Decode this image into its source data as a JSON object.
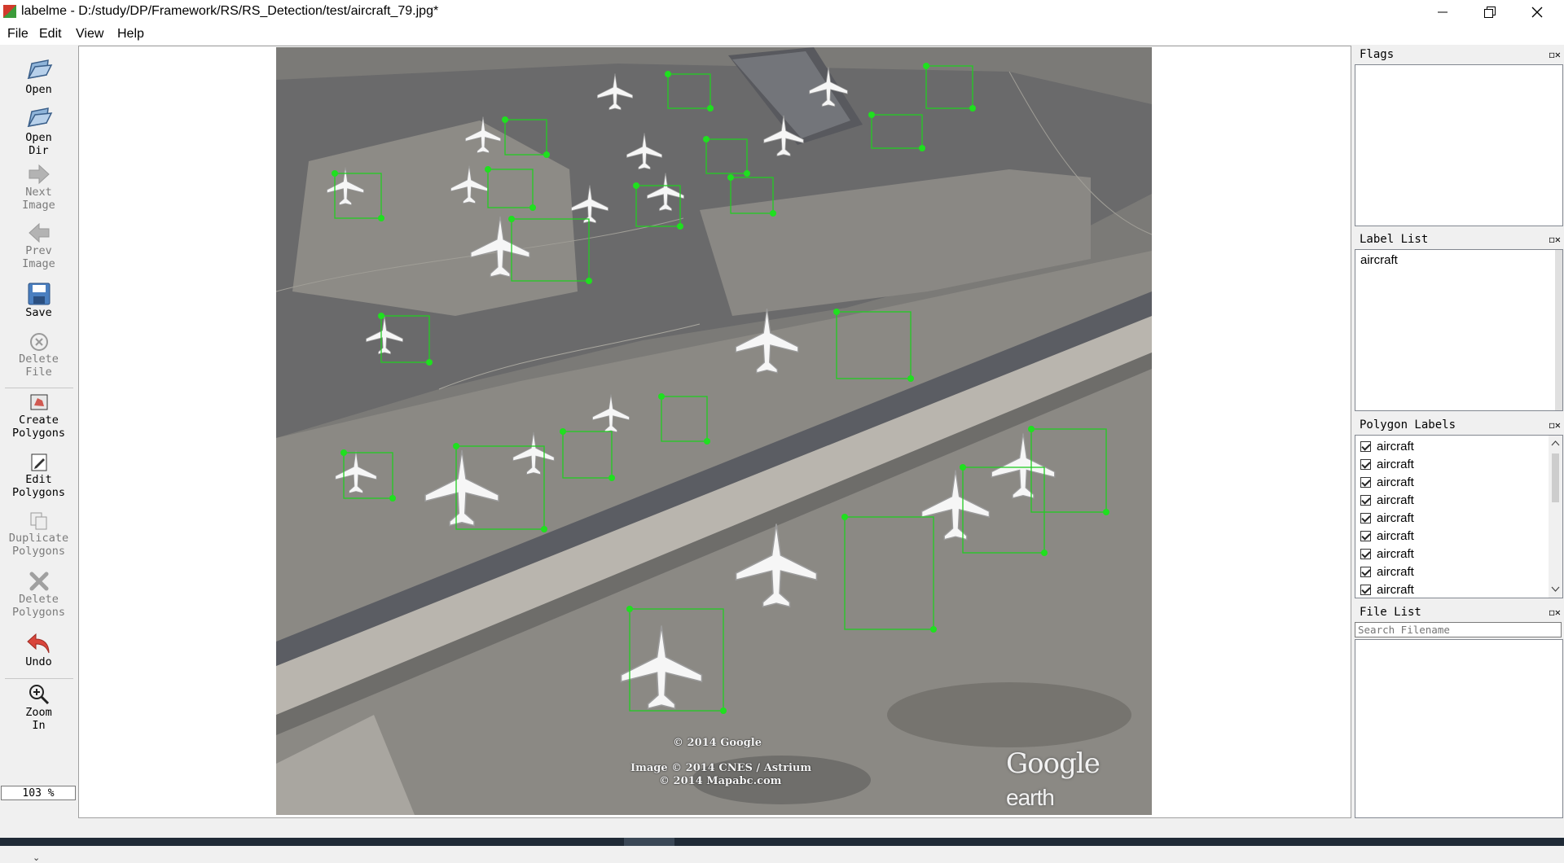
{
  "window": {
    "title": "labelme - D:/study/DP/Framework/RS/RS_Detection/test/aircraft_79.jpg*",
    "app_icon": "labelme-icon",
    "controls": [
      "minimize-icon",
      "restore-icon",
      "close-icon"
    ]
  },
  "menu": {
    "file": "File",
    "edit": "Edit",
    "view": "View",
    "help": "Help"
  },
  "toolbar": {
    "open": {
      "label": "Open",
      "icon": "folder-open-icon"
    },
    "open_dir": {
      "label": "Open\nDir",
      "icon": "folder-open-icon"
    },
    "next_image": {
      "label": "Next\nImage",
      "icon": "arrow-right-icon",
      "enabled": false
    },
    "prev_image": {
      "label": "Prev\nImage",
      "icon": "arrow-left-icon",
      "enabled": false
    },
    "save": {
      "label": "Save",
      "icon": "floppy-disk-icon"
    },
    "delete_file": {
      "label": "Delete\nFile",
      "icon": "delete-circle-icon",
      "enabled": false
    },
    "create_polygons": {
      "label": "Create\nPolygons",
      "icon": "create-polygon-icon"
    },
    "edit_polygons": {
      "label": "Edit\nPolygons",
      "icon": "edit-pencil-icon"
    },
    "duplicate_polygons": {
      "label": "Duplicate\nPolygons",
      "icon": "copy-icon",
      "enabled": false
    },
    "delete_polygons": {
      "label": "Delete\nPolygons",
      "icon": "delete-x-icon",
      "enabled": false
    },
    "undo": {
      "label": "Undo",
      "icon": "undo-arrow-icon"
    },
    "zoom_in": {
      "label": "Zoom\nIn",
      "icon": "magnifier-plus-icon"
    },
    "zoom_value": "103 %"
  },
  "image": {
    "file": "aircraft_79.jpg",
    "box_color": "#22cc22",
    "vertex_color": "#1fe01f",
    "credits": {
      "copyright_google": "© 2014 Google",
      "image_credit": "Image © 2014 CNES / Astrium",
      "mapabc": "© 2014 Mapabc.com",
      "brand": "Google",
      "brand_suffix": "earth"
    }
  },
  "docks": {
    "flags": {
      "title": "Flags"
    },
    "label_list": {
      "title": "Label List",
      "items": [
        "aircraft"
      ]
    },
    "polygon_labels": {
      "title": "Polygon Labels",
      "items": [
        {
          "label": "aircraft",
          "checked": true
        },
        {
          "label": "aircraft",
          "checked": true
        },
        {
          "label": "aircraft",
          "checked": true
        },
        {
          "label": "aircraft",
          "checked": true
        },
        {
          "label": "aircraft",
          "checked": true
        },
        {
          "label": "aircraft",
          "checked": true
        },
        {
          "label": "aircraft",
          "checked": true
        },
        {
          "label": "aircraft",
          "checked": true
        },
        {
          "label": "aircraft",
          "checked": true
        }
      ]
    },
    "file_list": {
      "title": "File List",
      "search_placeholder": "Search Filename"
    }
  }
}
